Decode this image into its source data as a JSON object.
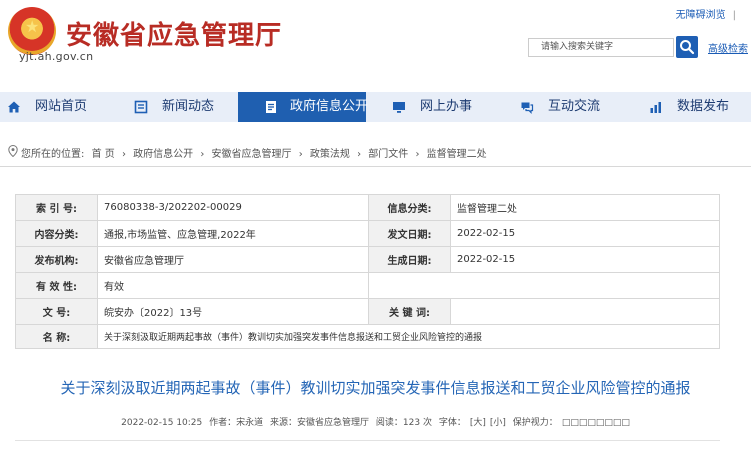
{
  "header": {
    "site_title": "安徽省应急管理厅",
    "site_url": "yjt.ah.gov.cn",
    "top_links": [
      "无障碍浏览",
      "|"
    ],
    "search_placeholder": "请输入搜索关键字",
    "advanced_search": "高级检索"
  },
  "nav": {
    "items": [
      {
        "label": "网站首页",
        "icon": "home-icon"
      },
      {
        "label": "新闻动态",
        "icon": "news-icon"
      },
      {
        "label": "政府信息公开",
        "icon": "document-icon",
        "active": true
      },
      {
        "label": "网上办事",
        "icon": "monitor-icon"
      },
      {
        "label": "互动交流",
        "icon": "chat-icon"
      },
      {
        "label": "数据发布",
        "icon": "chart-icon"
      }
    ],
    "active_color": "#1f5fb0"
  },
  "breadcrumb": {
    "prefix": "您所在的位置:",
    "items": [
      "首 页",
      "政府信息公开",
      "安徽省应急管理厅",
      "政策法规",
      "部门文件",
      "监督管理二处"
    ],
    "separator": "›"
  },
  "info": {
    "index_label": "索  引  号:",
    "index_value": "76080338-3/202202-00029",
    "info_class_label": "信息分类:",
    "info_class_value": "监督管理二处",
    "content_class_label": "内容分类:",
    "content_class_value": "通报,市场监管、应急管理,2022年",
    "issue_date_label": "发文日期:",
    "issue_date_value": "2022-02-15",
    "publisher_label": "发布机构:",
    "publisher_value": "安徽省应急管理厅",
    "effective_date_label": "生成日期:",
    "effective_date_value": "2022-02-15",
    "validity_label": "有 效 性:",
    "validity_value": "有效",
    "doc_no_label": "文          号:",
    "doc_no_value": "皖安办〔2022〕13号",
    "keywords_label": "关  键  词:",
    "keywords_value": "",
    "name_label": "名          称:",
    "name_value": "关于深刻汲取近期两起事故（事件）教训切实加强突发事件信息报送和工贸企业风险管控的通报"
  },
  "article": {
    "title": "关于深刻汲取近期两起事故（事件）教训切实加强突发事件信息报送和工贸企业风险管控的通报",
    "date": "2022-02-15 10:25",
    "author": "作者：宋永道",
    "source": "来源：安徽省应急管理厅",
    "views": "阅读：123 次",
    "font_label": "字体：",
    "font_large": "[大]",
    "font_small": "[小]",
    "protect_label": "保护视力：",
    "protect_colors": "□□□□□□□□"
  }
}
